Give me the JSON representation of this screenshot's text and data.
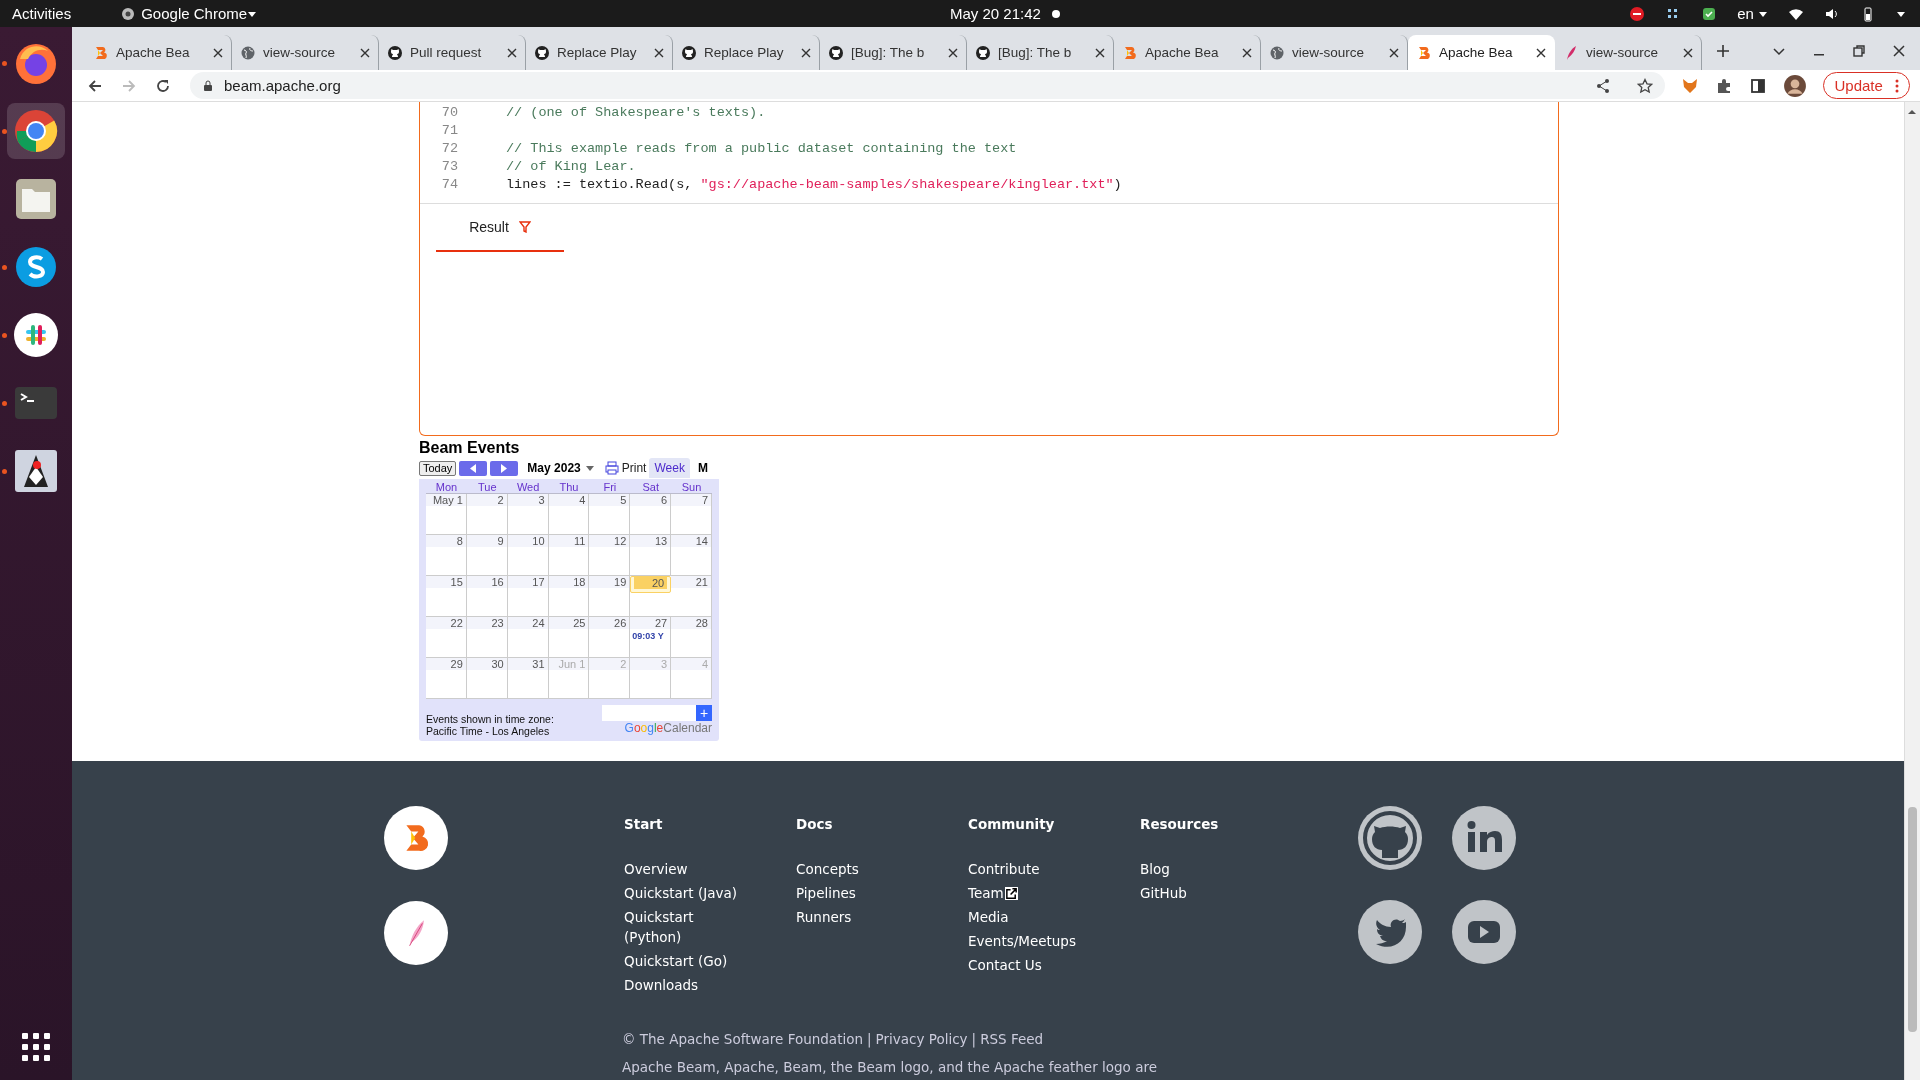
{
  "topbar": {
    "activities": "Activities",
    "app": "Google Chrome",
    "clock": "May 20  21:42",
    "lang": "en"
  },
  "dock": [
    {
      "kind": "firefox",
      "running": true,
      "selected": false
    },
    {
      "kind": "chrome",
      "running": true,
      "selected": true
    },
    {
      "kind": "files",
      "running": false,
      "selected": false
    },
    {
      "kind": "skype",
      "running": true,
      "selected": false
    },
    {
      "kind": "slack",
      "running": true,
      "selected": false
    },
    {
      "kind": "terminal",
      "running": true,
      "selected": false
    },
    {
      "kind": "java",
      "running": true,
      "selected": false
    }
  ],
  "tabs": [
    {
      "title": "Apache Bea",
      "kind": "beam",
      "selected": false
    },
    {
      "title": "view-source",
      "kind": "globe",
      "selected": false
    },
    {
      "title": "Pull request",
      "kind": "github",
      "selected": false
    },
    {
      "title": "Replace Play",
      "kind": "github",
      "selected": false
    },
    {
      "title": "Replace Play",
      "kind": "github",
      "selected": false
    },
    {
      "title": "[Bug]: The b",
      "kind": "github",
      "selected": false
    },
    {
      "title": "[Bug]: The b",
      "kind": "github",
      "selected": false
    },
    {
      "title": "Apache Bea",
      "kind": "beam",
      "selected": false
    },
    {
      "title": "view-source",
      "kind": "globe",
      "selected": false
    },
    {
      "title": "Apache Bea",
      "kind": "beam",
      "selected": true
    },
    {
      "title": "view-source",
      "kind": "feather",
      "selected": false
    }
  ],
  "address": "beam.apache.org",
  "update_button": "Update",
  "code": [
    {
      "num": "70",
      "parts": [
        {
          "kind": "comment",
          "text": "// (one of Shakespeare's texts)."
        }
      ]
    },
    {
      "num": "71"
    },
    {
      "num": "72",
      "parts": [
        {
          "kind": "comment",
          "text": "// This example reads from a public dataset containing the text"
        }
      ]
    },
    {
      "num": "73",
      "parts": [
        {
          "kind": "comment",
          "text": "// of King Lear."
        }
      ]
    },
    {
      "num": "74",
      "parts": [
        {
          "kind": "plain",
          "text": "lines := textio.Read(s, "
        },
        {
          "kind": "string",
          "text": "\"gs://apache-beam-samples/shakespeare/kinglear.txt\""
        },
        {
          "kind": "plain",
          "text": ")"
        }
      ]
    }
  ],
  "result_tab": {
    "label": "Result",
    "selected": true
  },
  "calendar": {
    "title": "Beam Events",
    "today": "Today",
    "month": "May 2023",
    "print": "Print",
    "views": [
      {
        "label": "Week",
        "selected": false
      },
      {
        "label": "M",
        "selected": true
      }
    ],
    "weekdays": [
      "Mon",
      "Tue",
      "Wed",
      "Thu",
      "Fri",
      "Sat",
      "Sun"
    ],
    "weeks": [
      [
        {
          "day": "May 1",
          "other": false,
          "today": false
        },
        {
          "day": "2",
          "other": false,
          "today": false
        },
        {
          "day": "3",
          "other": false,
          "today": false
        },
        {
          "day": "4",
          "other": false,
          "today": false
        },
        {
          "day": "5",
          "other": false,
          "today": false
        },
        {
          "day": "6",
          "other": false,
          "today": false
        },
        {
          "day": "7",
          "other": false,
          "today": false
        }
      ],
      [
        {
          "day": "8",
          "other": false,
          "today": false
        },
        {
          "day": "9",
          "other": false,
          "today": false
        },
        {
          "day": "10",
          "other": false,
          "today": false
        },
        {
          "day": "11",
          "other": false,
          "today": false
        },
        {
          "day": "12",
          "other": false,
          "today": false
        },
        {
          "day": "13",
          "other": false,
          "today": false
        },
        {
          "day": "14",
          "other": false,
          "today": false
        }
      ],
      [
        {
          "day": "15",
          "other": false,
          "today": false
        },
        {
          "day": "16",
          "other": false,
          "today": false
        },
        {
          "day": "17",
          "other": false,
          "today": false
        },
        {
          "day": "18",
          "other": false,
          "today": false
        },
        {
          "day": "19",
          "other": false,
          "today": false
        },
        {
          "day": "20",
          "other": false,
          "today": true
        },
        {
          "day": "21",
          "other": false,
          "today": false
        }
      ],
      [
        {
          "day": "22",
          "other": false,
          "today": false
        },
        {
          "day": "23",
          "other": false,
          "today": false
        },
        {
          "day": "24",
          "other": false,
          "today": false
        },
        {
          "day": "25",
          "other": false,
          "today": false
        },
        {
          "day": "26",
          "other": false,
          "today": false
        },
        {
          "day": "27",
          "other": false,
          "today": false,
          "event": "09:03 Y"
        },
        {
          "day": "28",
          "other": false,
          "today": false
        }
      ],
      [
        {
          "day": "29",
          "other": false,
          "today": false
        },
        {
          "day": "30",
          "other": false,
          "today": false
        },
        {
          "day": "31",
          "other": false,
          "today": false
        },
        {
          "day": "Jun 1",
          "other": true,
          "today": false
        },
        {
          "day": "2",
          "other": true,
          "today": false
        },
        {
          "day": "3",
          "other": true,
          "today": false
        },
        {
          "day": "4",
          "other": true,
          "today": false
        }
      ]
    ],
    "timezone_label": "Events shown in time zone:",
    "timezone": "Pacific Time - Los Angeles",
    "brand": "Google",
    "brand_product": "Calendar",
    "add": "+"
  },
  "footer": {
    "columns": [
      {
        "heading": "Start",
        "items": [
          {
            "label": "Overview",
            "external": false
          },
          {
            "label": "Quickstart (Java)",
            "external": false
          },
          {
            "label": "Quickstart (Python)",
            "external": false
          },
          {
            "label": "Quickstart (Go)",
            "external": false
          },
          {
            "label": "Downloads",
            "external": false
          }
        ]
      },
      {
        "heading": "Docs",
        "items": [
          {
            "label": "Concepts",
            "external": false
          },
          {
            "label": "Pipelines",
            "external": false
          },
          {
            "label": "Runners",
            "external": false
          }
        ]
      },
      {
        "heading": "Community",
        "items": [
          {
            "label": "Contribute",
            "external": false
          },
          {
            "label": "Team",
            "external": true
          },
          {
            "label": "Media",
            "external": false
          },
          {
            "label": "Events/Meetups",
            "external": false
          },
          {
            "label": "Contact Us",
            "external": false
          }
        ]
      },
      {
        "heading": "Resources",
        "items": [
          {
            "label": "Blog",
            "external": false
          },
          {
            "label": "GitHub",
            "external": false
          }
        ]
      }
    ],
    "social": [
      {
        "kind": "github"
      },
      {
        "kind": "linkedin"
      },
      {
        "kind": "twitter"
      },
      {
        "kind": "youtube"
      }
    ],
    "copyright": "© The Apache Software Foundation",
    "links": [
      {
        "separator": "|",
        "label": "Privacy Policy"
      },
      {
        "separator": "|",
        "label": "RSS Feed"
      }
    ],
    "legal": "Apache Beam, Apache, Beam, the Beam logo, and the Apache feather logo are"
  }
}
